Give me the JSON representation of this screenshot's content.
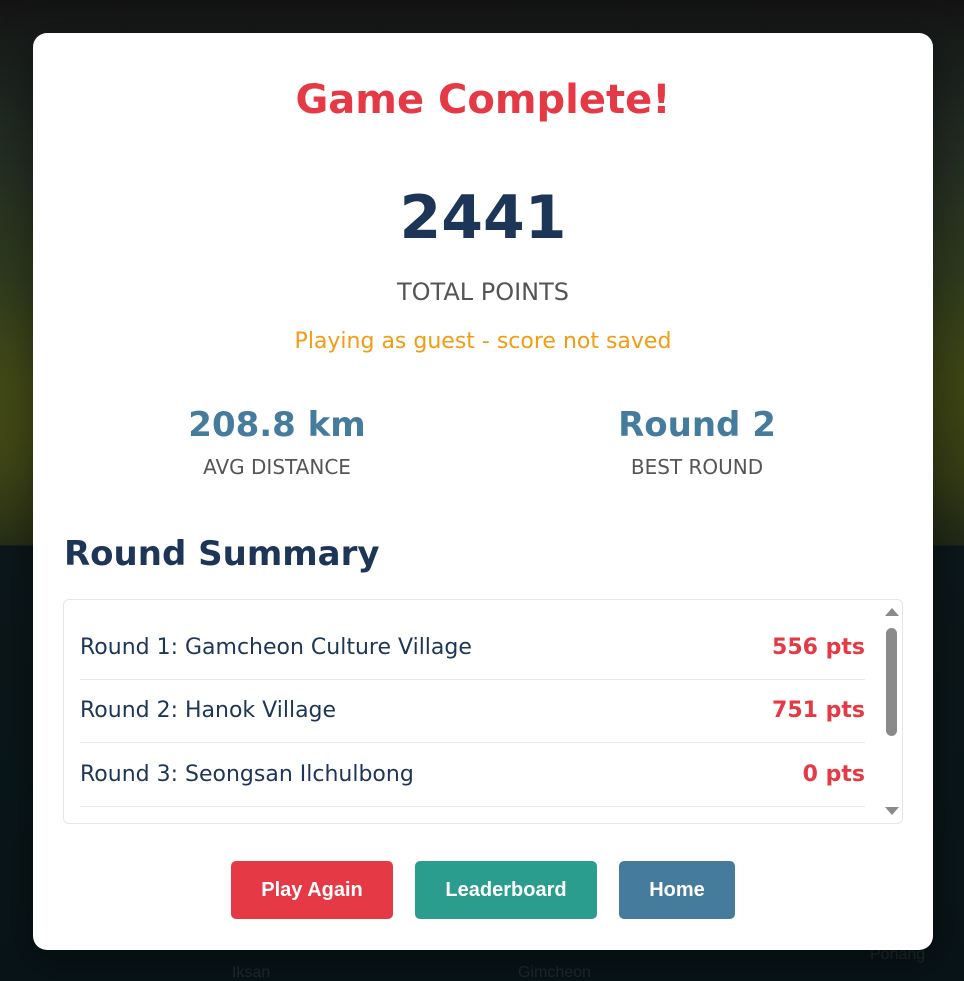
{
  "background": {
    "map_labels": [
      "Iksan",
      "Gimcheon",
      "Pohang"
    ]
  },
  "modal": {
    "title": "Game Complete!",
    "total_points": "2441",
    "total_points_label": "TOTAL POINTS",
    "guest_note": "Playing as guest - score not saved",
    "stats": {
      "avg_distance": {
        "value": "208.8 km",
        "label": "AVG DISTANCE"
      },
      "best_round": {
        "value": "Round 2",
        "label": "BEST ROUND"
      }
    },
    "summary_heading": "Round Summary",
    "rounds": [
      {
        "name": "Round 1: Gamcheon Culture Village",
        "points": "556 pts"
      },
      {
        "name": "Round 2: Hanok Village",
        "points": "751 pts"
      },
      {
        "name": "Round 3: Seongsan Ilchulbong",
        "points": "0 pts"
      }
    ],
    "buttons": {
      "play_again": "Play Again",
      "leaderboard": "Leaderboard",
      "home": "Home"
    }
  },
  "colors": {
    "accent_red": "#e63946",
    "navy": "#1d3557",
    "steel_blue": "#457b9d",
    "teal": "#2a9d8f",
    "warning_orange": "#f39c12"
  }
}
